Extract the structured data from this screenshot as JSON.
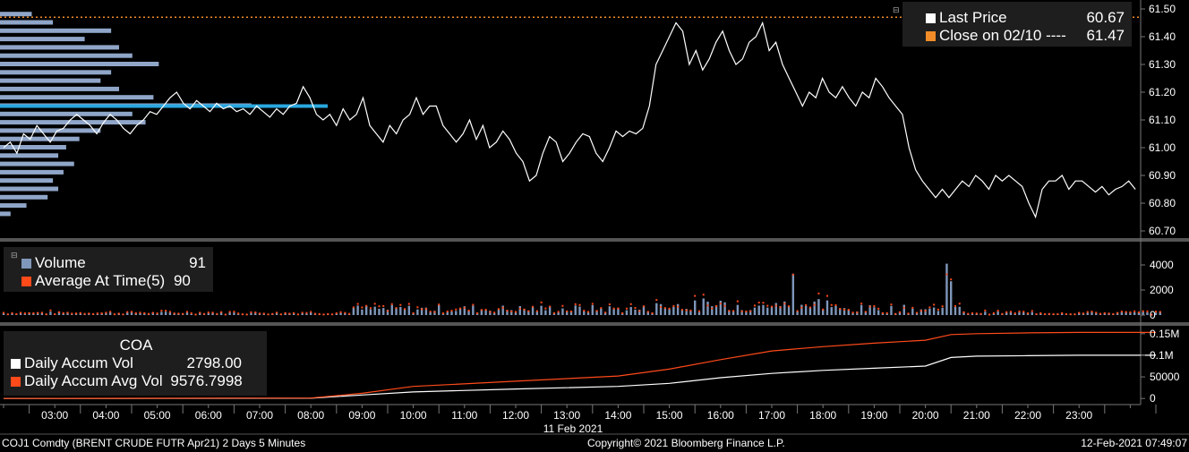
{
  "colors": {
    "background": "#000000",
    "panel": "#181818",
    "price_line": "#ffffff",
    "close_ref": "#f28c28",
    "volume_bars": "#7f97bb",
    "avg_volume": "#ff4a1a",
    "accum_vol": "#ffffff",
    "accum_avg": "#ff4a1a",
    "profile_bars": "#8fa6c8",
    "profile_poc": "#2aa8e0",
    "grid": "#2a2a2a",
    "separator": "#555555"
  },
  "price_legend": {
    "last_price_label": "Last Price",
    "last_price_value": "60.67",
    "close_label": "Close on 02/10 ----",
    "close_value": "61.47"
  },
  "volume_legend": {
    "volume_label": "Volume",
    "volume_value": "91",
    "avg_label": "Average At Time(5)",
    "avg_value": "90"
  },
  "accum_legend": {
    "title": "COA",
    "daily_label": "Daily Accum Vol",
    "daily_value": "2798.00",
    "avg_label": "Daily Accum Avg Vol",
    "avg_value": "9576.7998"
  },
  "footer": {
    "security": "COJ1 Comdty (BRENT CRUDE FUTR  Apr21) 2 Days 5 Minutes",
    "copyright": "Copyright© 2021 Bloomberg Finance L.P.",
    "timestamp": "12-Feb-2021 07:49:07"
  },
  "chart_data": [
    {
      "type": "line",
      "panel": "price",
      "series": [
        {
          "name": "Last Price",
          "x_hours": [
            2.0,
            2.13,
            2.26,
            2.39,
            2.52,
            2.65,
            2.78,
            2.91,
            3.04,
            3.17,
            3.3,
            3.43,
            3.56,
            3.69,
            3.82,
            3.95,
            4.08,
            4.21,
            4.34,
            4.47,
            4.6,
            4.73,
            4.86,
            4.99,
            5.12,
            5.25,
            5.38,
            5.51,
            5.64,
            5.77,
            5.9,
            6.03,
            6.16,
            6.29,
            6.42,
            6.55,
            6.68,
            6.81,
            6.94,
            7.07,
            7.2,
            7.33,
            7.46,
            7.59,
            7.72,
            7.85,
            7.98,
            8.11,
            8.24,
            8.37,
            8.5,
            8.63,
            8.76,
            8.89,
            9.02,
            9.15,
            9.28,
            9.41,
            9.54,
            9.67,
            9.8,
            9.93,
            10.06,
            10.19,
            10.32,
            10.45,
            10.58,
            10.71,
            10.84,
            10.97,
            11.1,
            11.23,
            11.36,
            11.49,
            11.62,
            11.75,
            11.88,
            12.01,
            12.14,
            12.27,
            12.4,
            12.53,
            12.66,
            12.79,
            12.92,
            13.05,
            13.18,
            13.31,
            13.44,
            13.57,
            13.7,
            13.83,
            13.96,
            14.09,
            14.22,
            14.35,
            14.48,
            14.61,
            14.74,
            14.87,
            15.0,
            15.13,
            15.26,
            15.39,
            15.52,
            15.65,
            15.78,
            15.91,
            16.04,
            16.17,
            16.3,
            16.43,
            16.56,
            16.69,
            16.82,
            16.95,
            17.08,
            17.21,
            17.34,
            17.47,
            17.6,
            17.73,
            17.86,
            17.99,
            18.12,
            18.25,
            18.38,
            18.51,
            18.64,
            18.77,
            18.9,
            19.03,
            19.16,
            19.29,
            19.42,
            19.55,
            19.68,
            19.81,
            19.94,
            20.07,
            20.2,
            20.33,
            20.46,
            20.59,
            20.72,
            20.85,
            20.98,
            21.11,
            21.24,
            21.37,
            21.5,
            21.63,
            21.76,
            21.89,
            22.02,
            22.15,
            22.28,
            22.41,
            22.54,
            22.67,
            22.8,
            22.93,
            23.06,
            23.19,
            23.32,
            23.45,
            23.58,
            23.71,
            23.84,
            23.97,
            24.1,
            24.23,
            24.36,
            24.49,
            24.6
          ],
          "values": [
            61.0,
            61.02,
            60.98,
            61.05,
            61.03,
            61.08,
            61.05,
            61.02,
            61.06,
            61.07,
            61.1,
            61.12,
            61.1,
            61.08,
            61.05,
            61.09,
            61.12,
            61.1,
            61.07,
            61.05,
            61.08,
            61.1,
            61.13,
            61.12,
            61.15,
            61.18,
            61.2,
            61.16,
            61.14,
            61.17,
            61.15,
            61.13,
            61.16,
            61.14,
            61.15,
            61.13,
            61.14,
            61.12,
            61.15,
            61.13,
            61.11,
            61.14,
            61.12,
            61.15,
            61.16,
            61.22,
            61.18,
            61.12,
            61.1,
            61.12,
            61.08,
            61.14,
            61.1,
            61.12,
            61.18,
            61.08,
            61.05,
            61.02,
            61.08,
            61.05,
            61.1,
            61.12,
            61.18,
            61.12,
            61.15,
            61.15,
            61.08,
            61.05,
            61.02,
            61.05,
            61.1,
            61.03,
            61.08,
            61.0,
            61.02,
            61.06,
            61.03,
            60.98,
            60.95,
            60.88,
            60.9,
            60.98,
            61.04,
            61.02,
            60.95,
            60.98,
            61.02,
            61.05,
            61.04,
            60.98,
            60.95,
            61.0,
            61.06,
            61.04,
            61.06,
            61.05,
            61.07,
            61.15,
            61.3,
            61.35,
            61.4,
            61.45,
            61.42,
            61.3,
            61.35,
            61.28,
            61.32,
            61.38,
            61.42,
            61.35,
            61.3,
            61.32,
            61.38,
            61.4,
            61.45,
            61.35,
            61.38,
            61.3,
            61.25,
            61.2,
            61.15,
            61.2,
            61.18,
            61.25,
            61.2,
            61.18,
            61.22,
            61.18,
            61.15,
            61.2,
            61.18,
            61.25,
            61.22,
            61.18,
            61.15,
            61.12,
            61.0,
            60.92,
            60.88,
            60.85,
            60.82,
            60.85,
            60.82,
            60.85,
            60.88,
            60.86,
            60.9,
            60.88,
            60.85,
            60.9,
            60.88,
            60.9,
            60.88,
            60.86,
            60.8,
            60.75,
            60.85,
            60.88,
            60.88,
            60.9,
            60.85,
            60.88,
            60.88,
            60.86,
            60.84,
            60.86,
            60.83,
            60.85,
            60.86,
            60.88,
            60.85
          ]
        },
        {
          "name": "Close on 02/10",
          "value": 61.47
        }
      ],
      "ylim": [
        60.7,
        61.5
      ],
      "yticks": [
        "61.50",
        "61.40",
        "61.30",
        "61.20",
        "61.10",
        "61.00",
        "60.90",
        "60.80",
        "60.70"
      ],
      "ytick_values": [
        61.5,
        61.4,
        61.3,
        61.2,
        61.1,
        61.0,
        60.9,
        60.8,
        60.7
      ],
      "volume_profile": {
        "poc_price": 61.15,
        "bins_price": [
          61.48,
          61.45,
          61.42,
          61.39,
          61.36,
          61.33,
          61.3,
          61.27,
          61.24,
          61.21,
          61.18,
          61.15,
          61.12,
          61.09,
          61.06,
          61.03,
          61.0,
          60.97,
          60.94,
          60.91,
          60.88,
          60.85,
          60.82,
          60.79,
          60.76
        ],
        "bins_volume": [
          12000,
          20000,
          42000,
          32000,
          45000,
          50000,
          60000,
          42000,
          38000,
          45000,
          58000,
          95000,
          50000,
          55000,
          38000,
          30000,
          25000,
          22000,
          28000,
          24000,
          20000,
          22000,
          18000,
          10000,
          4000
        ]
      },
      "grid": false,
      "legend_position": "top-right"
    },
    {
      "type": "bar",
      "panel": "volume",
      "series_names": [
        "Volume",
        "Average At Time(5)"
      ],
      "ylim": [
        0,
        5000
      ],
      "yticks": [
        "4000",
        "2000",
        "0"
      ],
      "ytick_values": [
        4000,
        2000,
        0
      ],
      "legend_position": "top-left"
    },
    {
      "type": "line",
      "panel": "accum",
      "series": [
        {
          "name": "Daily Accum Vol",
          "x_hours": [
            2,
            8,
            9,
            10,
            12,
            14,
            15,
            16,
            17,
            18,
            19,
            20,
            20.5,
            21,
            22,
            23,
            24.5
          ],
          "values": [
            0,
            500,
            8000,
            15000,
            22000,
            28000,
            35000,
            48000,
            58000,
            65000,
            70000,
            75000,
            95000,
            98000,
            99000,
            100000,
            100000
          ]
        },
        {
          "name": "Daily Accum Avg Vol",
          "x_hours": [
            2,
            8,
            9,
            10,
            12,
            14,
            15,
            16,
            17,
            18,
            19,
            20,
            20.5,
            21,
            22,
            23,
            24.5
          ],
          "values": [
            0,
            1000,
            12000,
            28000,
            40000,
            52000,
            68000,
            90000,
            110000,
            120000,
            128000,
            135000,
            148000,
            150000,
            152000,
            153000,
            153000
          ]
        }
      ],
      "ylim": [
        -10000,
        160000
      ],
      "yticks": [
        "0.15M",
        "0.1M",
        "50000",
        "0"
      ],
      "ytick_values": [
        150000,
        100000,
        50000,
        0
      ],
      "legend_position": "top-left"
    }
  ],
  "x_axis": {
    "ticks": [
      "03:00",
      "04:00",
      "05:00",
      "06:00",
      "07:00",
      "08:00",
      "09:00",
      "10:00",
      "11:00",
      "12:00",
      "13:00",
      "14:00",
      "15:00",
      "16:00",
      "17:00",
      "18:00",
      "19:00",
      "20:00",
      "21:00",
      "22:00",
      "23:00"
    ],
    "tick_hours": [
      3,
      4,
      5,
      6,
      7,
      8,
      9,
      10,
      11,
      12,
      13,
      14,
      15,
      16,
      17,
      18,
      19,
      20,
      21,
      22,
      23
    ],
    "date_label": "11 Feb 2021"
  }
}
